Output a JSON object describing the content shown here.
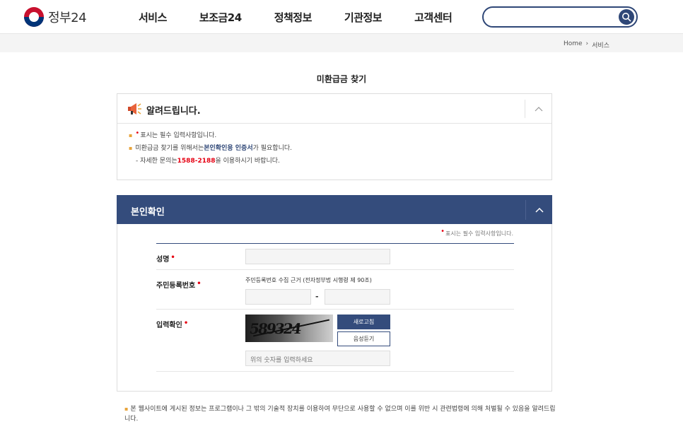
{
  "header": {
    "logo_text": "정부24",
    "nav": [
      "서비스",
      "보조금24",
      "정책정보",
      "기관정보",
      "고객센터"
    ],
    "search_placeholder": ""
  },
  "breadcrumb": {
    "home": "Home",
    "separator": "›",
    "current": "서비스"
  },
  "page_title": "미환급금 찾기",
  "notice": {
    "title": "알려드립니다.",
    "lines": {
      "required_text": "표시는 필수 입력사항입니다.",
      "cert_prefix": "미환급금 찾기를 위해서는 ",
      "cert_highlight": "본인확인용 인증서",
      "cert_suffix": "가 필요합니다.",
      "contact_prefix": "- 자세한 문의는 ",
      "contact_phone": "1588-2188",
      "contact_suffix": "을 이용하시기 바랍니다."
    }
  },
  "identity": {
    "title": "본인확인",
    "required_note": "표시는 필수 입력사항입니다.",
    "name_label": "성명",
    "rrn_label": "주민등록번호",
    "rrn_hint": "주민등록번호 수집 근거 (전자정부법 시행령 제 90조)",
    "rrn_dash": "-",
    "captcha_label": "입력확인",
    "captcha_text": "589324",
    "refresh_button": "새로고침",
    "audio_button": "음성듣기",
    "captcha_placeholder": "위의 숫자를 입력하세요"
  },
  "footer_note": "본 웹사이트에 게시된 정보는 프로그램이나 그 밖의 기술적 장치를 이용하여 무단으로 사용할 수 없으며 이를 위반 시 관련법령에 의해 처벌될 수 있음을 알려드립니다.",
  "colors": {
    "brand_navy": "#344c7c",
    "required_red": "#e60012",
    "bullet_orange": "#e8a43b"
  }
}
